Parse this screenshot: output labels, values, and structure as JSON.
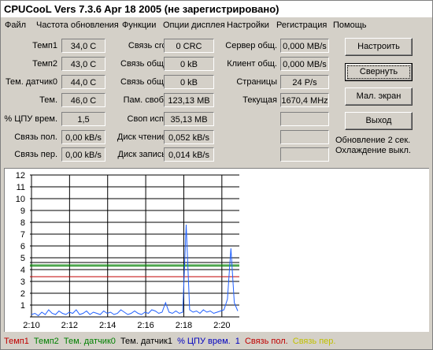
{
  "title": "CPUCooL  Vers 7.3.6  Apr 18 2005  (не зарегистрировано)",
  "menu": [
    "Файл",
    "Частота обновления",
    "Функции",
    "Опции дисплея",
    "Настройки",
    "Регистрация",
    "Помощь"
  ],
  "col1": [
    {
      "label": "Темп1",
      "value": "34,0 C"
    },
    {
      "label": "Темп2",
      "value": "43,0 C"
    },
    {
      "label": "Тем. датчик0",
      "value": "44,0 C"
    },
    {
      "label": "Тем.",
      "value": "46,0 C"
    },
    {
      "label": "% ЦПУ врем.",
      "value": "1,5"
    },
    {
      "label": "Связь пол.",
      "value": "0,00 kB/s"
    },
    {
      "label": "Связь пер.",
      "value": "0,00 kB/s"
    }
  ],
  "col2": [
    {
      "label": "Связь crc",
      "value": "0 CRC"
    },
    {
      "label": "Связь общ.",
      "value": "0 kB"
    },
    {
      "label": "Связь общ.",
      "value": "0 kB"
    },
    {
      "label": "Пам. своб.",
      "value": "123,13 MB"
    },
    {
      "label": "Своп исп.",
      "value": "35,13 MB"
    },
    {
      "label": "Диск чтение",
      "value": "0,052 kB/s"
    },
    {
      "label": "Диск запись",
      "value": "0,014 kB/s"
    }
  ],
  "col3": [
    {
      "label": "Сервер общ.",
      "value": "0,000 MB/s"
    },
    {
      "label": "Клиент общ.",
      "value": "0,000 MB/s"
    },
    {
      "label": "Страницы",
      "value": "24 P/s"
    },
    {
      "label": "Текущая",
      "value": "1670,4 MHz"
    },
    {
      "label": "",
      "value": ""
    },
    {
      "label": "",
      "value": ""
    },
    {
      "label": "",
      "value": ""
    }
  ],
  "buttons": {
    "settings": "Настроить",
    "minimize": "Свернуть",
    "small_screen": "Мал. экран",
    "exit": "Выход"
  },
  "status": {
    "update": "Обновление 2 сек.",
    "cooling": "Охлаждение выкл."
  },
  "legend": [
    {
      "name": "Темп1",
      "color": "#c00000"
    },
    {
      "name": "Темп2",
      "color": "#008000"
    },
    {
      "name": "Тем. датчик0",
      "color": "#008000"
    },
    {
      "name": "Тем. датчик1",
      "color": "#000000"
    },
    {
      "name": "% ЦПУ врем.",
      "color": "#0000c0"
    },
    {
      "name": "1",
      "color": "#0000c0"
    },
    {
      "name": "Связь пол.",
      "color": "#c00000"
    },
    {
      "name": "Связь пер.",
      "color": "#c0c000"
    }
  ],
  "chart_data": {
    "type": "line",
    "ylim": [
      0,
      12
    ],
    "yticks": [
      "1",
      "2",
      "3",
      "4",
      "5",
      "6",
      "7",
      "8",
      "9",
      "10",
      "11",
      "12"
    ],
    "xticks": [
      "2:10",
      "2:12",
      "2:14",
      "2:16",
      "2:18",
      "2:20"
    ],
    "grid": true,
    "series": [
      {
        "name": "Темп1",
        "color": "#c00000",
        "level": 3.4
      },
      {
        "name": "Темп2",
        "color": "#008000",
        "level": 4.3
      },
      {
        "name": "Тем. датчик0",
        "color": "#008000",
        "level": 4.4
      },
      {
        "name": "Тем. датчик1",
        "color": "#000000",
        "level": 4.6
      },
      {
        "name": "% ЦПУ врем.",
        "color": "#2060ff",
        "values": [
          0.2,
          0.3,
          0.1,
          0.4,
          0.2,
          0.6,
          0.3,
          0.2,
          0.5,
          0.3,
          0.2,
          0.4,
          0.3,
          0.6,
          0.2,
          0.3,
          0.5,
          0.2,
          0.4,
          0.3,
          0.2,
          0.5,
          0.3,
          0.4,
          0.2,
          0.3,
          0.6,
          0.4,
          0.2,
          0.3,
          0.5,
          0.3,
          0.2,
          0.4,
          0.3,
          0.6,
          0.5,
          0.3,
          0.4,
          1.2,
          0.4,
          0.3,
          0.5,
          0.3,
          0.4,
          7.8,
          0.6,
          0.4,
          0.5,
          0.3,
          0.6,
          0.4,
          0.5,
          0.3,
          0.4,
          0.5,
          0.6,
          1.5,
          5.8,
          1.2,
          0.5
        ]
      }
    ]
  }
}
